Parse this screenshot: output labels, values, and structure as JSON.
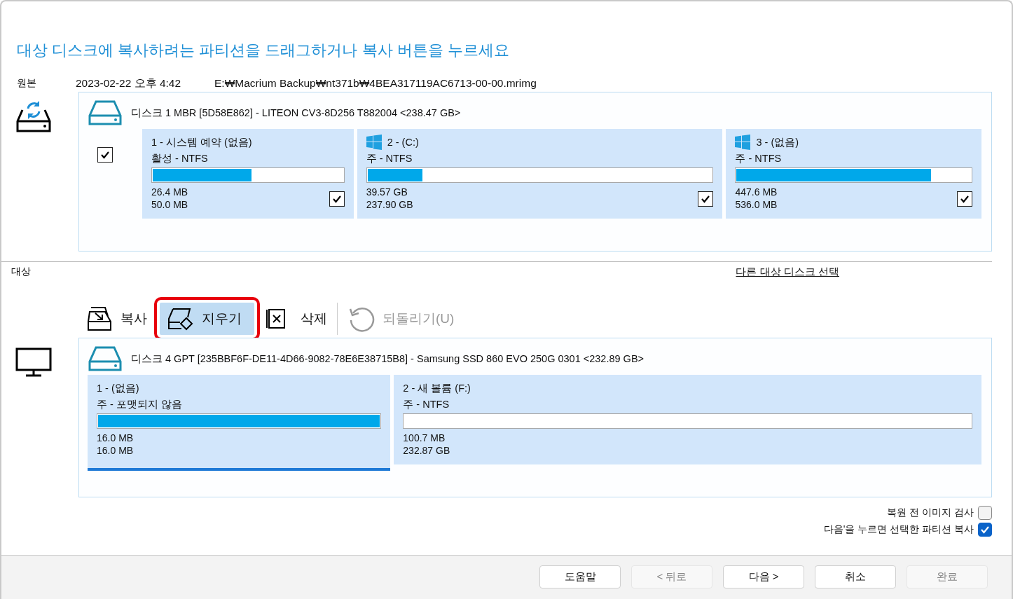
{
  "heading": "대상 디스크에 복사하려는 파티션을 드래그하거나 복사 버튼을 누르세요",
  "source": {
    "label": "원본",
    "date": "2023-02-22 오후 4:42",
    "path": "E:₩Macrium Backup₩nt371b₩4BEA317119AC6713-00-00.mrimg",
    "disk": {
      "title": "디스크 1 MBR [5D58E862] - LITEON CV3-8D256 T882004  <238.47 GB>",
      "checked": true,
      "partitions": [
        {
          "name": "1 - 시스템 예약 (없음)",
          "windows": false,
          "type": "활성 - NTFS",
          "level": 0.52,
          "used": "26.4 MB",
          "total": "50.0 MB",
          "checked": true,
          "selected": false
        },
        {
          "name": "2 -  (C:)",
          "windows": true,
          "type": "주 - NTFS",
          "level": 0.16,
          "used": "39.57 GB",
          "total": "237.90 GB",
          "checked": true,
          "selected": false
        },
        {
          "name": "3 -  (없음)",
          "windows": true,
          "type": "주 - NTFS",
          "level": 0.83,
          "used": "447.6 MB",
          "total": "536.0 MB",
          "checked": true,
          "selected": false
        }
      ]
    }
  },
  "target": {
    "label": "대상",
    "link": "다른 대상 디스크 선택",
    "toolbar": [
      {
        "kind": "copy",
        "label": "복사",
        "selected": false,
        "disabled": false
      },
      {
        "kind": "erase",
        "label": "지우기",
        "selected": true,
        "disabled": false
      },
      {
        "kind": "delete",
        "label": "삭제",
        "selected": false,
        "disabled": false
      },
      {
        "kind": "undo",
        "label": "되돌리기(U)",
        "selected": false,
        "disabled": true
      }
    ],
    "disk": {
      "title": "디스크 4 GPT [235BBF6F-DE11-4D66-9082-78E6E38715B8] - Samsung  SSD 860 EVO 250G 0301  <232.89 GB>",
      "partitions": [
        {
          "name": "1 -  (없음)",
          "windows": false,
          "type": "주 - 포맷되지 않음",
          "level": 1,
          "used": "16.0 MB",
          "total": "16.0 MB",
          "selected": true
        },
        {
          "name": "2 - 새 볼륨 (F:)",
          "windows": false,
          "type": "주 - NTFS",
          "level": 0,
          "used": "100.7 MB",
          "total": "232.87 GB",
          "selected": false
        }
      ]
    }
  },
  "options": [
    {
      "label": "복원 전 이미지 검사",
      "checked": false
    },
    {
      "label": "다음'을 누르면 선택한 파티션 복사",
      "checked": true
    }
  ],
  "buttons": [
    {
      "label": "도움말",
      "disabled": false
    },
    {
      "label": "< 뒤로",
      "disabled": true
    },
    {
      "label": "다음 >",
      "disabled": false
    },
    {
      "label": "취소",
      "disabled": false
    },
    {
      "label": "완료",
      "disabled": true
    }
  ]
}
